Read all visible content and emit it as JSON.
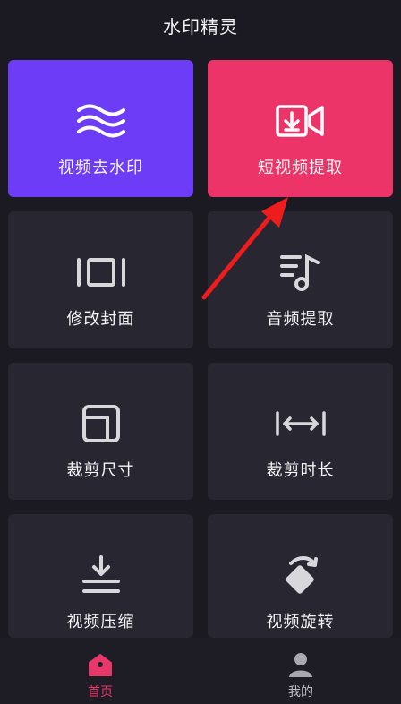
{
  "header": {
    "title": "水印精灵"
  },
  "tools": [
    {
      "label": "视频去水印",
      "icon": "waves-icon"
    },
    {
      "label": "短视频提取",
      "icon": "video-download-icon"
    },
    {
      "label": "修改封面",
      "icon": "cover-frames-icon"
    },
    {
      "label": "音频提取",
      "icon": "music-note-icon"
    },
    {
      "label": "裁剪尺寸",
      "icon": "crop-square-icon"
    },
    {
      "label": "裁剪时长",
      "icon": "trim-duration-icon"
    },
    {
      "label": "视频压缩",
      "icon": "compress-icon"
    },
    {
      "label": "视频旋转",
      "icon": "rotate-icon"
    }
  ],
  "tabbar": {
    "home_label": "首页",
    "mine_label": "我的"
  },
  "colors": {
    "background": "#1b1a22",
    "tile": "#282731",
    "tile_purple": "#6d3cf6",
    "tile_pink": "#ec3468",
    "accent": "#e8386a",
    "annotation_arrow": "#ee1c1c"
  }
}
